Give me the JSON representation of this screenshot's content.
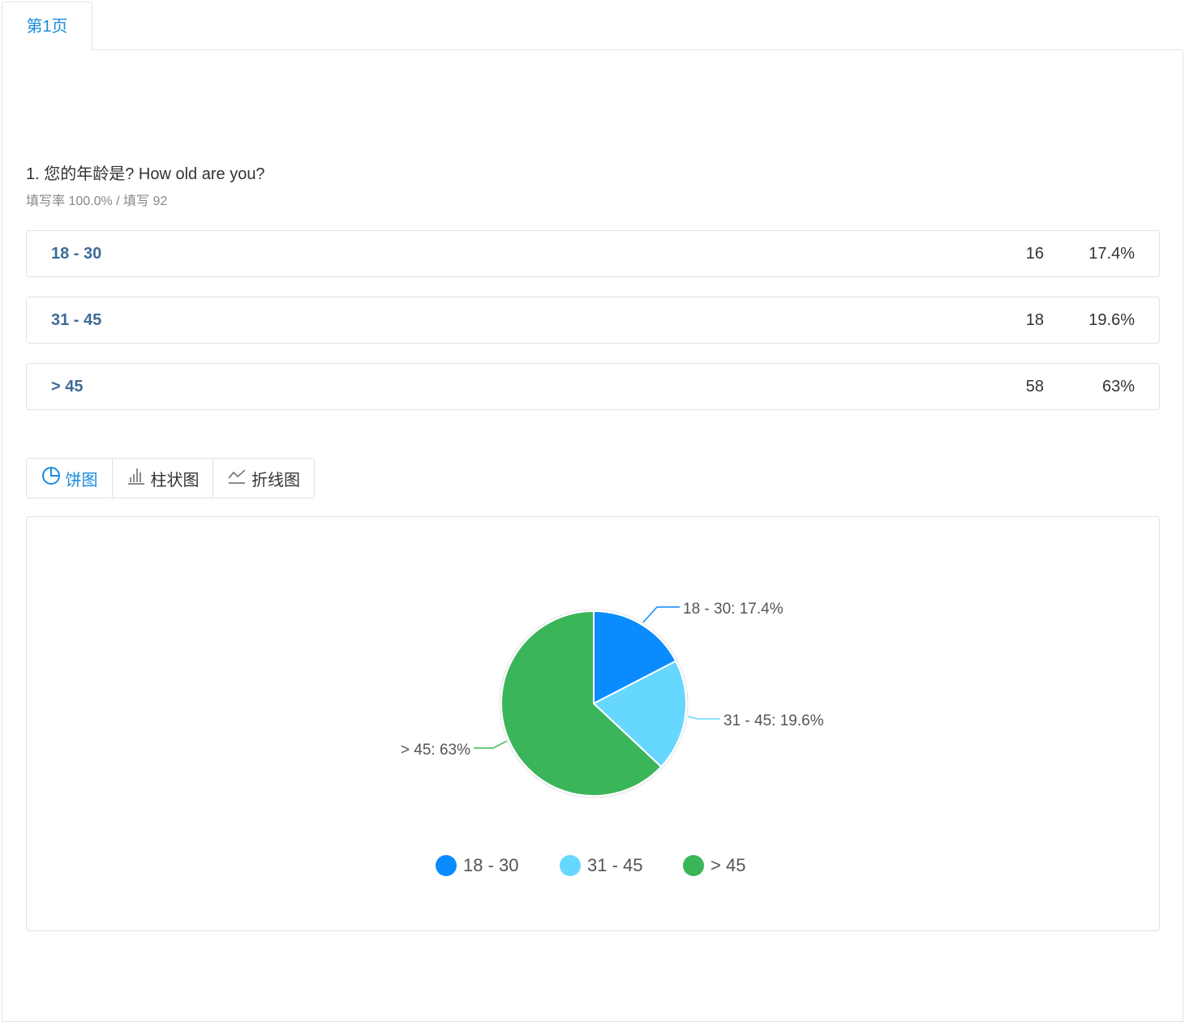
{
  "tabs": [
    {
      "label": "第1页"
    }
  ],
  "question": {
    "title": "1. 您的年龄是? How old are you?",
    "meta": "填写率 100.0% / 填写 92"
  },
  "options": [
    {
      "label": "18 - 30",
      "count": "16",
      "percent": "17.4%"
    },
    {
      "label": "31 - 45",
      "count": "18",
      "percent": "19.6%"
    },
    {
      "label": "> 45",
      "count": "58",
      "percent": "63%"
    }
  ],
  "chart_switcher": [
    {
      "label": "饼图",
      "icon": "pie-chart-icon",
      "active": true
    },
    {
      "label": "柱状图",
      "icon": "bar-chart-icon",
      "active": false
    },
    {
      "label": "折线图",
      "icon": "line-chart-icon",
      "active": false
    }
  ],
  "colors": {
    "accent": "#1a8cdb",
    "option_label": "#3e6b96",
    "border": "#dde3ec"
  },
  "chart_data": {
    "type": "pie",
    "categories": [
      "18 - 30",
      "31 - 45",
      "> 45"
    ],
    "values": [
      17.4,
      19.6,
      63
    ],
    "slice_labels": [
      "18 - 30: 17.4%",
      "31 - 45: 19.6%",
      "> 45: 63%"
    ],
    "colors": [
      "#0a8cff",
      "#66d7ff",
      "#3bb55a"
    ],
    "legend": [
      "18 - 30",
      "31 - 45",
      "> 45"
    ],
    "legend_position": "bottom"
  }
}
